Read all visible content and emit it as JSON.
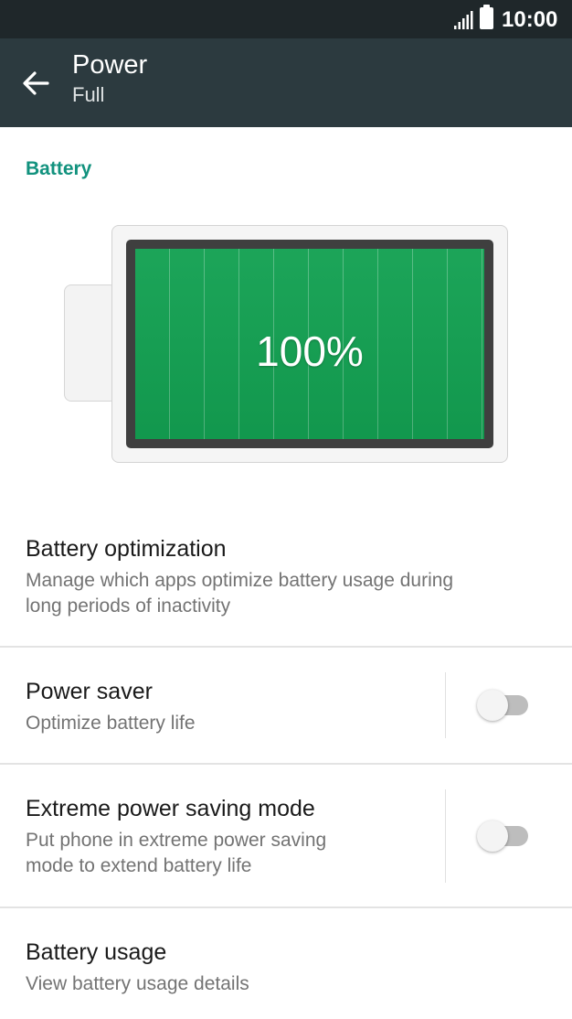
{
  "status_bar": {
    "time": "10:00",
    "icons": [
      "signal-icon",
      "battery-icon"
    ]
  },
  "app_bar": {
    "back_icon": "arrow-back-icon",
    "title": "Power",
    "subtitle": "Full"
  },
  "battery_section": {
    "header": "Battery",
    "level_label": "100%",
    "level_fraction": 1.0,
    "fill_color": "#13a152"
  },
  "settings": {
    "battery_optimization": {
      "title": "Battery optimization",
      "summary_line1": "Manage which apps optimize battery usage during",
      "summary_line2": "long periods of inactivity"
    },
    "power_saver": {
      "title": "Power saver",
      "summary": "Optimize battery life",
      "enabled": false
    },
    "extreme_power_saving": {
      "title": "Extreme power saving mode",
      "summary_line1": "Put phone in extreme power saving",
      "summary_line2": "mode to extend battery life",
      "enabled": false
    },
    "battery_usage": {
      "title": "Battery usage",
      "summary": "View battery usage details"
    }
  },
  "colors": {
    "status_bar": "#1f272a",
    "app_bar": "#2c3a3f",
    "accent": "#12927e",
    "battery_green": "#13a152"
  }
}
